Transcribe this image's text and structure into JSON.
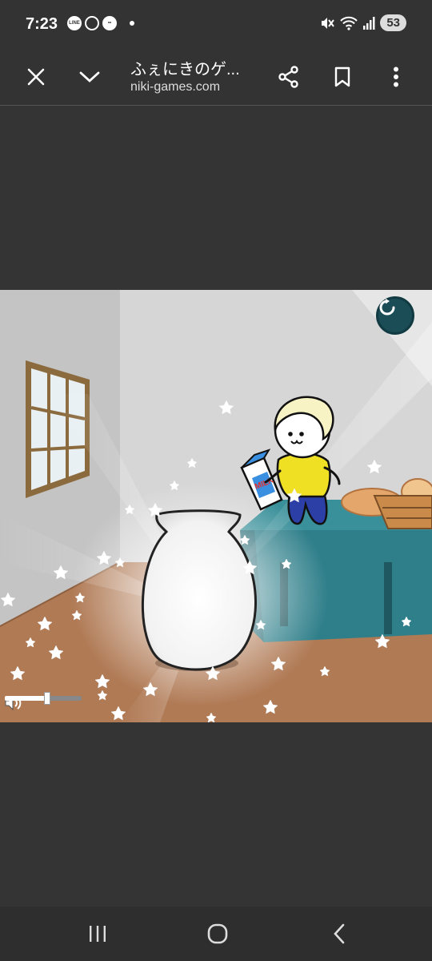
{
  "status_bar": {
    "time": "7:23",
    "left_icons": [
      "line-icon",
      "chat-bubble-icon",
      "eyes-icon"
    ],
    "right_icons": [
      "mute-icon",
      "wifi-icon",
      "signal-icon"
    ],
    "battery": "53"
  },
  "toolbar": {
    "title": "ふぇにきのゲ...",
    "url": "niki-games.com",
    "buttons": [
      "close-icon",
      "chevron-down-icon",
      "share-icon",
      "bookmark-icon",
      "more-vert-icon"
    ]
  },
  "game": {
    "milk_carton_label": "MILK",
    "volume_level": 0.55,
    "reload_icon": "reload-icon",
    "colors": {
      "wall": "#d4d4d4",
      "floor": "#b07a55",
      "table": "#2f7f8a",
      "reload": "#1b4d57"
    }
  },
  "navbar": {
    "buttons": [
      "recents-icon",
      "home-icon",
      "back-icon"
    ]
  }
}
